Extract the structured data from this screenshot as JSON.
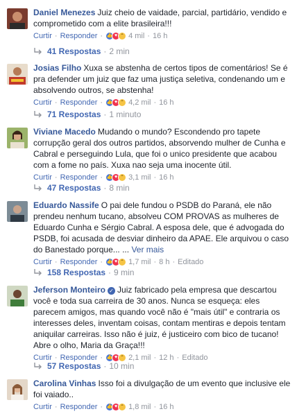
{
  "comments": [
    {
      "author": "Daniel Menezes",
      "verified": false,
      "text": "Juiz cheio de vaidade, parcial, partidário, vendido e comprometido com a elite brasileira!!!",
      "more": "",
      "like_label": "Curtir",
      "reply_label": "Responder",
      "reactions_count": "4 mil",
      "time": "16 h",
      "edited": "",
      "replies_label": "41 Respostas",
      "replies_time": "2 min",
      "avatar_color": "#7a3b2e"
    },
    {
      "author": "Josias Filho",
      "verified": false,
      "text": "Xuxa se abstenha de certos tipos de comentários! Se é pra defender um juiz que faz uma justiça seletiva, condenando um e absolvendo outros, se abstenha!",
      "more": "",
      "like_label": "Curtir",
      "reply_label": "Responder",
      "reactions_count": "4,2 mil",
      "time": "16 h",
      "edited": "",
      "replies_label": "71 Respostas",
      "replies_time": "1 minuto",
      "avatar_color": "#c23a2a"
    },
    {
      "author": "Viviane Macedo",
      "verified": false,
      "text": "Mudando o mundo? Escondendo pro tapete corrupção geral dos outros partidos, absorvendo mulher de Cunha e Cabral e perseguindo Lula, que foi o unico presidente que acabou com a fome no país. Xuxa nao seja uma inocente útil.",
      "more": "",
      "like_label": "Curtir",
      "reply_label": "Responder",
      "reactions_count": "3,1 mil",
      "time": "16 h",
      "edited": "",
      "replies_label": "47 Respostas",
      "replies_time": "8 min",
      "avatar_color": "#6f8a3e"
    },
    {
      "author": "Eduardo Nassife",
      "verified": false,
      "text": "O pai dele fundou o PSDB do Paraná, ele não prendeu nenhum tucano, absolveu COM PROVAS as mulheres de Eduardo Cunha e Sérgio Cabral. A esposa dele, que é advogada do PSDB, foi acusada de desviar dinheiro da APAE. Ele arquivou o caso do Banestado porque...",
      "more": "Ver mais",
      "like_label": "Curtir",
      "reply_label": "Responder",
      "reactions_count": "1,7 mil",
      "time": "8 h",
      "edited": "Editado",
      "replies_label": "158 Respostas",
      "replies_time": "9 min",
      "avatar_color": "#5d6d7a"
    },
    {
      "author": "Jeferson Monteiro",
      "verified": true,
      "text": "Juiz fabricado pela empresa que descartou você e toda sua carreira de 30 anos. Nunca se esqueça: eles parecem amigos, mas quando você não é \"mais útil\" e contraria os interesses deles, inventam coisas, contam mentiras e depois tentam aniquilar carreiras. Isso não é juiz, é justiceiro com bico de tucano!\nAbre o olho, Maria da Graça!!!",
      "more": "",
      "like_label": "Curtir",
      "reply_label": "Responder",
      "reactions_count": "2,1 mil",
      "time": "12 h",
      "edited": "Editado",
      "replies_label": "57 Respostas",
      "replies_time": "10 min",
      "avatar_color": "#3f7d3a"
    },
    {
      "author": "Carolina Vinhas",
      "verified": false,
      "text": "Isso foi a divulgação de um evento que inclusive ele foi vaiado..",
      "more": "",
      "like_label": "Curtir",
      "reply_label": "Responder",
      "reactions_count": "1,8 mil",
      "time": "16 h",
      "edited": "",
      "replies_label": "",
      "replies_time": "",
      "avatar_color": "#b48a6a"
    }
  ]
}
